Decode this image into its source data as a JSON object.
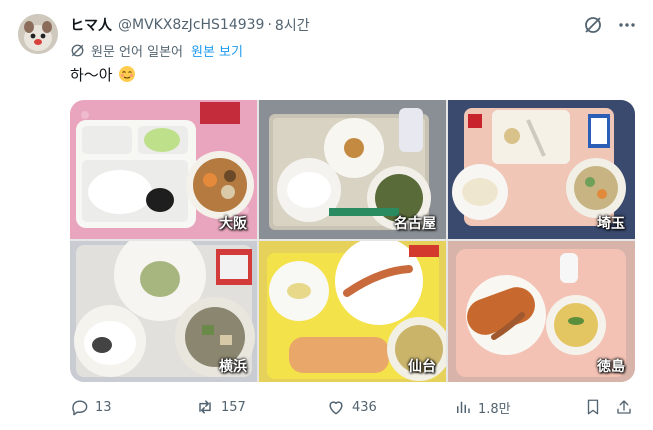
{
  "author": {
    "display_name": "ヒマ人",
    "handle": "@MVKX8zJcHS14939",
    "separator": "·",
    "time_ago": "8시간"
  },
  "translation": {
    "note": "원문 언어 일본어",
    "link_label": "원본 보기"
  },
  "tweet": {
    "text": "하〜아"
  },
  "media": {
    "tiles": [
      {
        "city": "大阪"
      },
      {
        "city": "名古屋"
      },
      {
        "city": "埼玉"
      },
      {
        "city": "横浜"
      },
      {
        "city": "仙台"
      },
      {
        "city": "徳島"
      }
    ]
  },
  "actions": {
    "replies": "13",
    "reposts": "157",
    "likes": "436",
    "views": "1.8만"
  },
  "colors": {
    "link": "#1d9bf0",
    "muted": "#536471",
    "text": "#0f1419"
  }
}
